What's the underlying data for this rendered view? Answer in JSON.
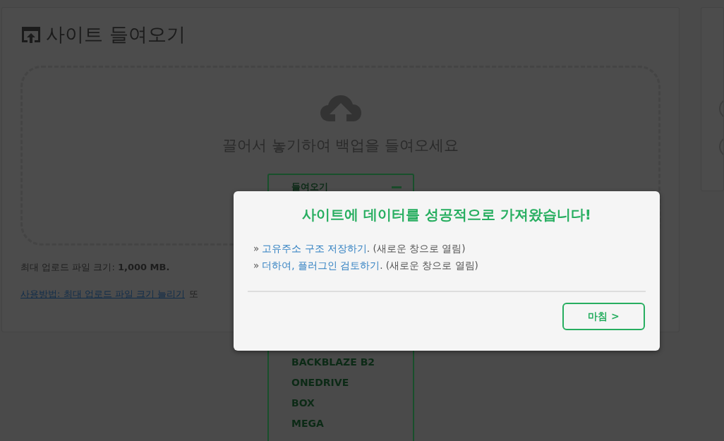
{
  "page_title": "사이트 들여오기",
  "dropzone": {
    "prompt": "끌어서 놓기하여 백업을 들여오세요",
    "import_menu": {
      "label": "들여오기",
      "expanded": true,
      "items": [
        "BACKBLAZE B2",
        "ONEDRIVE",
        "BOX",
        "MEGA"
      ]
    }
  },
  "max_upload": "최대 업로드 파일 크기: **1,000 MB.**",
  "help_link": "사용방법: 최대 업로드 파일 크기 늘리기",
  "help_suffix": "또",
  "dialog": {
    "title": "사이트에 데이터를 성공적으로 가져왔습니다!",
    "links": [
      {
        "bullet": "»",
        "link": "고유주소 구조 저장하기",
        "note": ". (새로운 창으로 열림)"
      },
      {
        "bullet": "»",
        "link": "더하여, 플러그인 검토하기",
        "note": ". (새로운 창으로 열림)"
      }
    ],
    "button": "마침 >"
  }
}
